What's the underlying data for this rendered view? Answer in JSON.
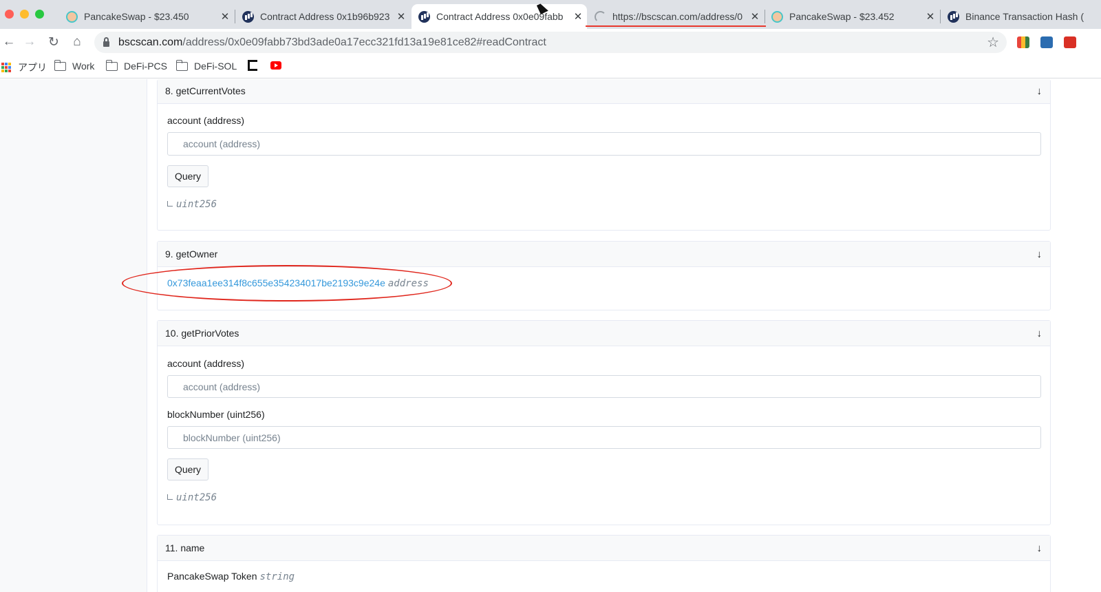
{
  "browser": {
    "tabs": [
      {
        "title": "PancakeSwap - $23.450",
        "favicon": "pancakeswap-icon"
      },
      {
        "title": "Contract Address 0x1b96b923",
        "favicon": "bscscan-icon"
      },
      {
        "title": "Contract Address 0x0e09fabb",
        "favicon": "bscscan-icon",
        "active": true
      },
      {
        "title": "https://bscscan.com/address/0",
        "favicon": "loading-icon"
      },
      {
        "title": "PancakeSwap - $23.452",
        "favicon": "pancakeswap-icon"
      },
      {
        "title": "Binance Transaction Hash (",
        "favicon": "bscscan-icon"
      }
    ],
    "close_glyph": "✕",
    "url_host": "bscscan.com",
    "url_path": "/address/0x0e09fabb73bd3ade0a17ecc321fd13a19e81ce82#readContract",
    "nav": {
      "back": "←",
      "forward": "→",
      "reload": "↻",
      "home": "⌂",
      "star": "☆"
    },
    "bookmarks": [
      {
        "label": "アプリ",
        "icon": "apps-grid-icon"
      },
      {
        "label": "Work",
        "icon": "folder-icon"
      },
      {
        "label": "DeFi-PCS",
        "icon": "folder-icon"
      },
      {
        "label": "DeFi-SOL",
        "icon": "folder-icon"
      }
    ],
    "accent": "#e8372c"
  },
  "contract": {
    "functions": [
      {
        "header": "8. getCurrentVotes",
        "inputs": [
          {
            "label": "account (address)",
            "placeholder": "account (address)"
          }
        ],
        "query_label": "Query",
        "return_type": "uint256"
      },
      {
        "header": "9. getOwner",
        "result_value": "0x73feaa1ee314f8c655e354234017be2193c9e24e",
        "result_type": "address"
      },
      {
        "header": "10. getPriorVotes",
        "inputs": [
          {
            "label": "account (address)",
            "placeholder": "account (address)"
          },
          {
            "label": "blockNumber (uint256)",
            "placeholder": "blockNumber (uint256)"
          }
        ],
        "query_label": "Query",
        "return_type": "uint256"
      },
      {
        "header": "11. name",
        "result_value": "PancakeSwap Token",
        "result_type": "string"
      }
    ],
    "expand_glyph": "↓",
    "link_color": "#3498db",
    "annotation_color": "#e0261c"
  }
}
